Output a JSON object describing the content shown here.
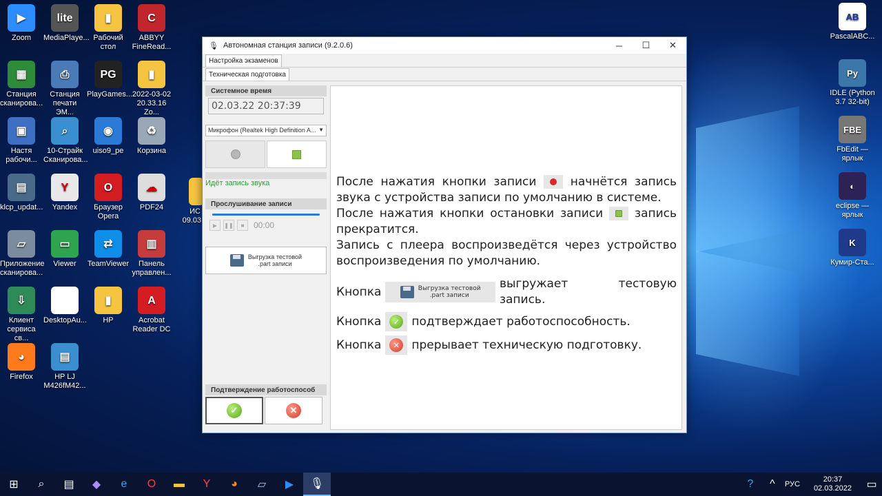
{
  "desktop": {
    "left_icons": [
      {
        "label": "Zoom",
        "color": "#2d8cff",
        "glyph": "▶"
      },
      {
        "label": "MediaPlaye...",
        "color": "#555555",
        "glyph": "lite"
      },
      {
        "label": "Рабочий стол",
        "color": "#f5c542",
        "glyph": "▮"
      },
      {
        "label": "ABBYY FineRead...",
        "color": "#c0262b",
        "glyph": "C"
      },
      {
        "label": "Станция сканирова...",
        "color": "#2e8b3a",
        "glyph": "▦"
      },
      {
        "label": "Станция печати ЭМ...",
        "color": "#4a7bb7",
        "glyph": "⎙"
      },
      {
        "label": "PlayGames...",
        "color": "#222222",
        "glyph": "PG"
      },
      {
        "label": "2022-03-02 20.33.16 Zo...",
        "color": "#f5c542",
        "glyph": "▮"
      },
      {
        "label": "Настя рабочи...",
        "color": "#3f6fc2",
        "glyph": "▣"
      },
      {
        "label": "10-Страйк Сканирова...",
        "color": "#3a8fd0",
        "glyph": "⌕"
      },
      {
        "label": "uiso9_pe",
        "color": "#2a7bd8",
        "glyph": "◉"
      },
      {
        "label": "Корзина",
        "color": "#9aa7b5",
        "glyph": "♻"
      },
      {
        "label": "klcp_updat...",
        "color": "#4a6a8a",
        "glyph": "▤"
      },
      {
        "label": "Yandex",
        "color": "#e8e8e8",
        "glyph": "Y"
      },
      {
        "label": "Браузер Opera",
        "color": "#d41d23",
        "glyph": "O"
      },
      {
        "label": "PDF24",
        "color": "#dddddd",
        "glyph": "☁"
      },
      {
        "label": "Приложение сканирова...",
        "color": "#7a8c9d",
        "glyph": "▱"
      },
      {
        "label": "Viewer",
        "color": "#2ea44f",
        "glyph": "▭"
      },
      {
        "label": "TeamViewer",
        "color": "#0e8ee9",
        "glyph": "⇄"
      },
      {
        "label": "Панель управлен...",
        "color": "#c63b3b",
        "glyph": "▥"
      },
      {
        "label": "Клиент сервиса св...",
        "color": "#2e8b57",
        "glyph": "⇩"
      },
      {
        "label": "DesktopAu...",
        "color": "#ffffff",
        "glyph": " "
      },
      {
        "label": "HP",
        "color": "#f5c542",
        "glyph": "▮"
      },
      {
        "label": "Acrobat Reader DC",
        "color": "#d41d23",
        "glyph": "A"
      },
      {
        "label": "Firefox",
        "color": "#ff7a1a",
        "glyph": "◕"
      },
      {
        "label": "HP LJ M426fM42...",
        "color": "#3a8fd0",
        "glyph": "▤"
      }
    ],
    "partial_icon": {
      "label": "ИС 09.03.2"
    },
    "right_icons": [
      {
        "label": "PascalABC...",
        "color": "#ffffff",
        "glyph": "AB"
      },
      {
        "label": "IDLE (Python 3.7 32-bit)",
        "color": "#3b77a8",
        "glyph": "Py"
      },
      {
        "label": "FbEdit — ярлык",
        "color": "#777777",
        "glyph": "FBE"
      },
      {
        "label": "eclipse — ярлык",
        "color": "#2c2255",
        "glyph": "◐"
      },
      {
        "label": "Кумир-Ста...",
        "color": "#1f3a8a",
        "glyph": "K"
      }
    ]
  },
  "window": {
    "title": "Автономная станция записи (9.2.0.6)",
    "tab_outer": "Настройка экзаменов",
    "tab_inner": "Техническая подготовка",
    "system_time_header": "Системное время",
    "system_time": "02.03.22 20:37:39",
    "microphone": "Микрофон (Realtek High Definition A...",
    "status": "Идёт запись звука",
    "playback_header": "Прослушивание записи",
    "playback_time": "00:00",
    "export_label_1": "Выгрузка тестовой",
    "export_label_2": ".part записи",
    "confirm_header": "Подтверждение работоспособ",
    "instructions": {
      "p1a": "После нажатия кнопки записи",
      "p1b": "начнётся запись звука с устройства записи по умолчанию в системе.",
      "p2a": "После нажатия кнопки остановки записи",
      "p2b": "запись прекратится.",
      "p3": "Запись с плеера воспроизведётся через устройство воспроизведения по умолчанию.",
      "k1a": "Кнопка",
      "k1b": "выгружает тестовую запись.",
      "k2a": "Кнопка",
      "k2b": "подтверждает работоспособность.",
      "k3a": "Кнопка",
      "k3b": "прерывает техническую подготовку."
    }
  },
  "taskbar": {
    "lang": "РУС",
    "time": "20:37",
    "date": "02.03.2022"
  }
}
